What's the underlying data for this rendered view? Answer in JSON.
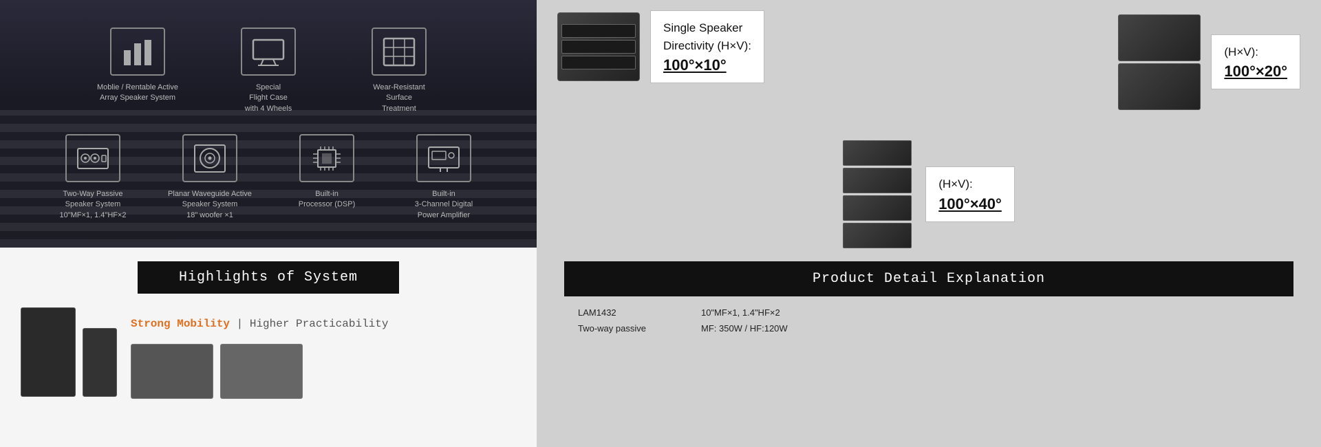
{
  "left": {
    "icons_row1": [
      {
        "id": "mobile-array",
        "label": "Moblie / Rentable\nActive Array\nSpeaker System",
        "icon_type": "bar-chart"
      },
      {
        "id": "flight-case",
        "label": "Special\nFlight Case\nwith 4 Wheels",
        "icon_type": "monitor"
      },
      {
        "id": "wear-resistant",
        "label": "Wear-Resistant\nSurface\nTreatment",
        "icon_type": "grid"
      }
    ],
    "icons_row2": [
      {
        "id": "two-way",
        "label": "Two-Way Passive\nSpeaker System\n10\"MF×1, 1.4\"HF×2",
        "icon_type": "speaker"
      },
      {
        "id": "planar-waveguide",
        "label": "Planar Waveguide Active\nSpeaker System\n18\" woofer ×1",
        "icon_type": "circle"
      },
      {
        "id": "builtin-dsp",
        "label": "Built-in\nProcessor (DSP)",
        "icon_type": "chip"
      },
      {
        "id": "builtin-amp",
        "label": "Built-in\n3-Channel Digital\nPower Amplifier",
        "icon_type": "display"
      }
    ],
    "highlights_banner": "Highlights of System",
    "strong_mobility": "Strong Mobility",
    "pipe": "|",
    "higher_practicability": " Higher Practicability"
  },
  "right": {
    "single_speaker": {
      "title": "Single Speaker\nDirectivity (H×V):",
      "value": "100°×10°"
    },
    "two_speaker": {
      "title": "(H×V):",
      "value": "100°×20°"
    },
    "four_speaker": {
      "title": "(H×V):",
      "value": "100°×40°"
    },
    "product_detail_banner": "Product Detail Explanation",
    "spec_model": "LAM1432",
    "spec_type": "Two-way passive",
    "spec_drivers": "10\"MF×1, 1.4\"HF×2",
    "spec_power": "MF: 350W / HF:120W"
  }
}
